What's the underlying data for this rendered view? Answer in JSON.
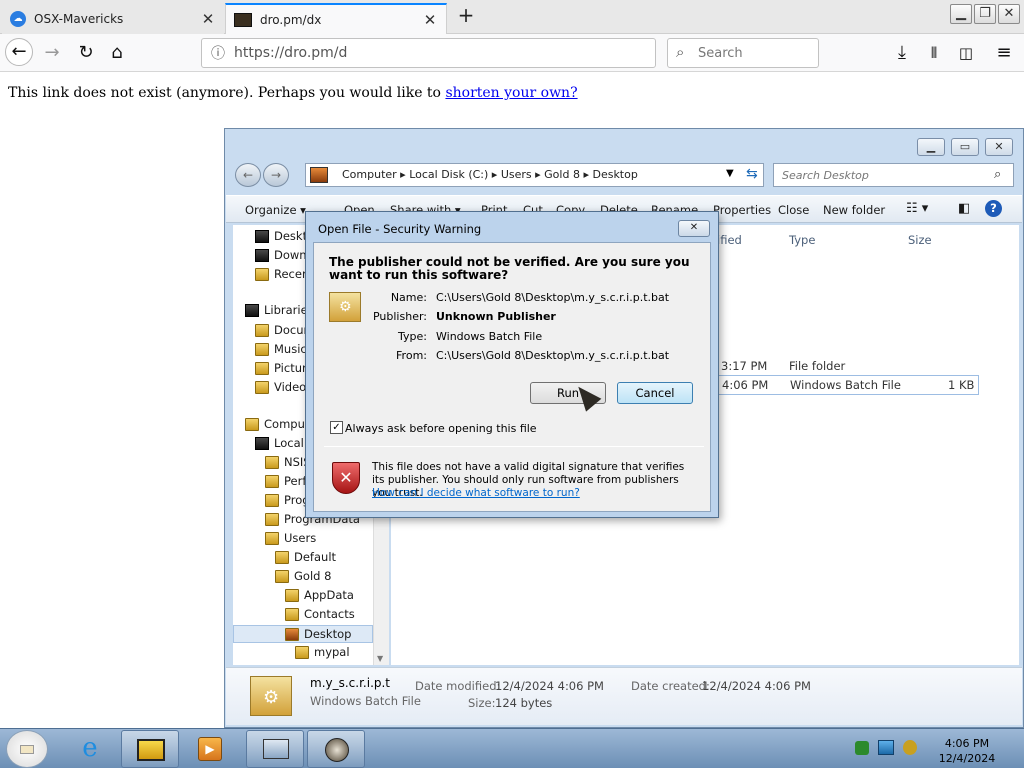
{
  "browser": {
    "tabs": [
      {
        "label": "OSX-Mavericks",
        "active": false
      },
      {
        "label": "dro.pm/dx",
        "active": true
      }
    ],
    "new_tab_label": "+",
    "url": "https://dro.pm/d",
    "search_placeholder": "Search"
  },
  "page": {
    "message": "This link does not exist (anymore). Perhaps you would like to",
    "link_text": "shorten your own?"
  },
  "explorer": {
    "breadcrumbs": [
      "Computer",
      "Local Disk (C:)",
      "Users",
      "Gold 8",
      "Desktop"
    ],
    "search_placeholder": "Search Desktop",
    "toolbar": [
      "Organize",
      "Open",
      "Share with",
      "Print",
      "Cut",
      "Copy",
      "Delete",
      "Rename",
      "Properties",
      "Close",
      "New folder"
    ],
    "nav_tree": [
      {
        "label": "Desktop",
        "level": 0
      },
      {
        "label": "Downloads",
        "level": 0
      },
      {
        "label": "Recent Places",
        "level": 0
      },
      {
        "label": "Libraries",
        "level": 0
      },
      {
        "label": "Documents",
        "level": 1
      },
      {
        "label": "Music",
        "level": 1
      },
      {
        "label": "Pictures",
        "level": 1
      },
      {
        "label": "Videos",
        "level": 1
      },
      {
        "label": "Computer",
        "level": 0
      },
      {
        "label": "Local Disk (C:)",
        "level": 1
      },
      {
        "label": "NSIS",
        "level": 2
      },
      {
        "label": "PerfLogs",
        "level": 2
      },
      {
        "label": "Program Files",
        "level": 2
      },
      {
        "label": "ProgramData",
        "level": 2
      },
      {
        "label": "Users",
        "level": 2
      },
      {
        "label": "Default",
        "level": 3
      },
      {
        "label": "Gold 8",
        "level": 3
      },
      {
        "label": "AppData",
        "level": 4
      },
      {
        "label": "Contacts",
        "level": 4
      },
      {
        "label": "Desktop",
        "level": 4
      },
      {
        "label": "mypal",
        "level": 5
      }
    ],
    "columns": [
      "Date modified",
      "Type",
      "Size"
    ],
    "columns_visible": [
      "ified",
      "Type",
      "Size"
    ],
    "rows": [
      {
        "date": "3:17 PM",
        "type": "File folder",
        "size": ""
      },
      {
        "date": "4:06 PM",
        "type": "Windows Batch File",
        "size": "1 KB"
      }
    ],
    "details": {
      "name": "m.y_s.c.r.i.p.t",
      "type": "Windows Batch File",
      "modified_label": "Date modified:",
      "modified": "12/4/2024 4:06 PM",
      "created_label": "Date created:",
      "created": "12/4/2024 4:06 PM",
      "size_label": "Size:",
      "size": "124 bytes"
    }
  },
  "dialog": {
    "title": "Open File - Security Warning",
    "question": "The publisher could not be verified.  Are you sure you want to run this software?",
    "fields": [
      {
        "label": "Name:",
        "value": "C:\\Users\\Gold 8\\Desktop\\m.y_s.c.r.i.p.t.bat",
        "bold": false
      },
      {
        "label": "Publisher:",
        "value": "Unknown Publisher",
        "bold": true
      },
      {
        "label": "Type:",
        "value": "Windows Batch File",
        "bold": false
      },
      {
        "label": "From:",
        "value": "C:\\Users\\Gold 8\\Desktop\\m.y_s.c.r.i.p.t.bat",
        "bold": false
      }
    ],
    "run_label": "Run",
    "cancel_label": "Cancel",
    "checkbox_label": "Always ask before opening this file",
    "checkbox_checked": true,
    "warning": "This file does not have a valid digital signature that verifies its publisher.  You should only run software from publishers you trust.",
    "help_link": "How can I decide what software to run?"
  },
  "taskbar": {
    "time": "4:06 PM",
    "date": "12/4/2024"
  },
  "colors": {
    "accent": "#0a84ff",
    "link": "#0000ee",
    "dialog_link": "#0066cc"
  }
}
